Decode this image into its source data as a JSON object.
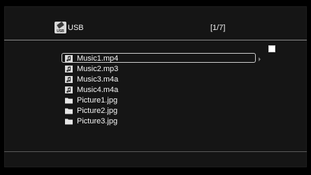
{
  "header": {
    "source_label": "USB",
    "page_indicator": "[1/7]",
    "source_icon": "usb-icon",
    "source_icon_text": "USB"
  },
  "files": [
    {
      "name": "Music1.mp4",
      "type": "music",
      "icon": "music-note-icon",
      "selected": true
    },
    {
      "name": "Music2.mp3",
      "type": "music",
      "icon": "music-note-icon",
      "selected": false
    },
    {
      "name": "Music3.m4a",
      "type": "music",
      "icon": "music-note-icon",
      "selected": false
    },
    {
      "name": "Music4.m4a",
      "type": "music",
      "icon": "music-note-icon",
      "selected": false
    },
    {
      "name": "Picture1.jpg",
      "type": "picture",
      "icon": "folder-icon",
      "selected": false
    },
    {
      "name": "Picture2.jpg",
      "type": "picture",
      "icon": "folder-icon",
      "selected": false
    },
    {
      "name": "Picture3.jpg",
      "type": "picture",
      "icon": "folder-icon",
      "selected": false
    }
  ],
  "colors": {
    "background": "#000000",
    "panel": "#151515",
    "text": "#f4f4f4",
    "divider": "#8a8a8a",
    "highlight_border": "#cfcfcf"
  }
}
